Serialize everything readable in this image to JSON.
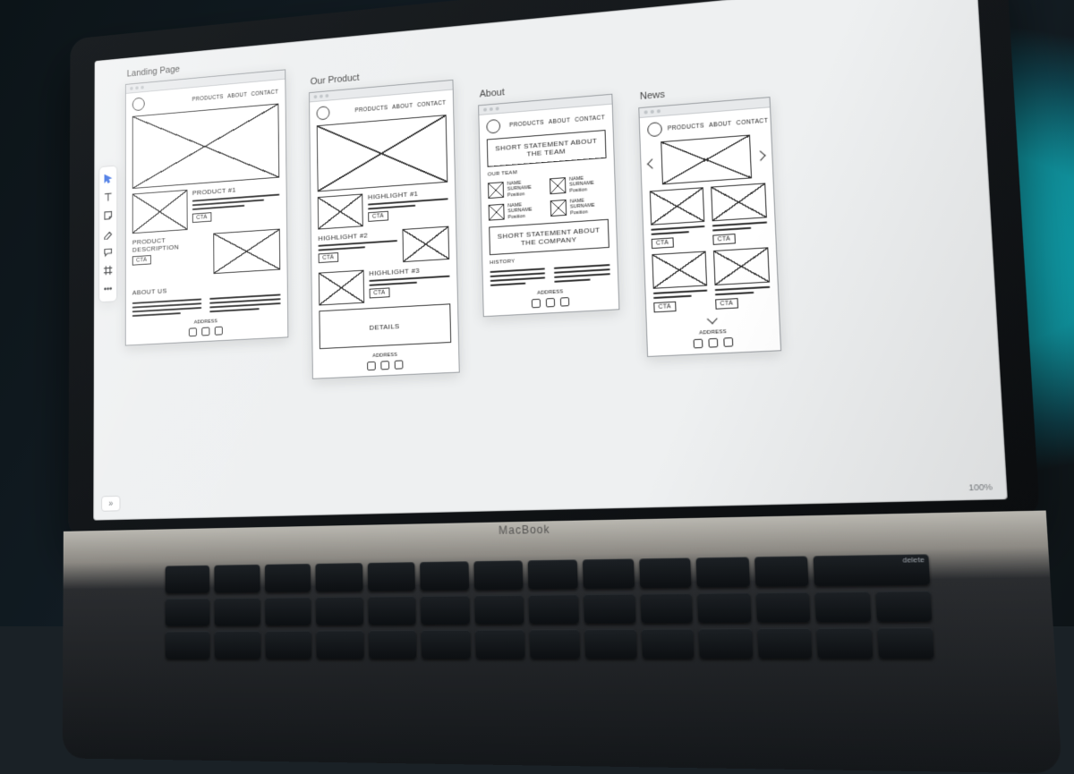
{
  "app": {
    "zoom_label": "100%",
    "footer_toggle_glyph": "»",
    "laptop_brand": "MacBook",
    "delete_key": "delete"
  },
  "toolbar": {
    "items": [
      {
        "id": "cursor",
        "name": "select-tool"
      },
      {
        "id": "text",
        "name": "text-tool"
      },
      {
        "id": "note",
        "name": "sticky-note-tool"
      },
      {
        "id": "pen",
        "name": "pen-tool"
      },
      {
        "id": "comment",
        "name": "comment-tool"
      },
      {
        "id": "frame",
        "name": "frame-tool"
      },
      {
        "id": "more",
        "name": "more-tools"
      }
    ]
  },
  "nav": {
    "products": "PRODUCTS",
    "about": "ABOUT",
    "contact": "CONTACT"
  },
  "common": {
    "cta": "CTA",
    "address": "ADDRESS"
  },
  "artboards": [
    {
      "title": "Landing Page",
      "product_heading": "PRODUCT #1",
      "desc_heading": "PRODUCT DESCRIPTION",
      "about_heading": "ABOUT US"
    },
    {
      "title": "Our Product",
      "highlights": [
        "HIGHLIGHT #1",
        "HIGHLIGHT #2",
        "HIGHLIGHT #3"
      ],
      "details_heading": "DETAILS"
    },
    {
      "title": "About",
      "team_statement": "SHORT STATEMENT ABOUT THE TEAM",
      "team_heading": "OUR TEAM",
      "member_name": "NAME SURNAME",
      "member_role": "Position",
      "company_statement": "SHORT STATEMENT ABOUT THE COMPANY",
      "history_heading": "HISTORY"
    },
    {
      "title": "News"
    }
  ]
}
